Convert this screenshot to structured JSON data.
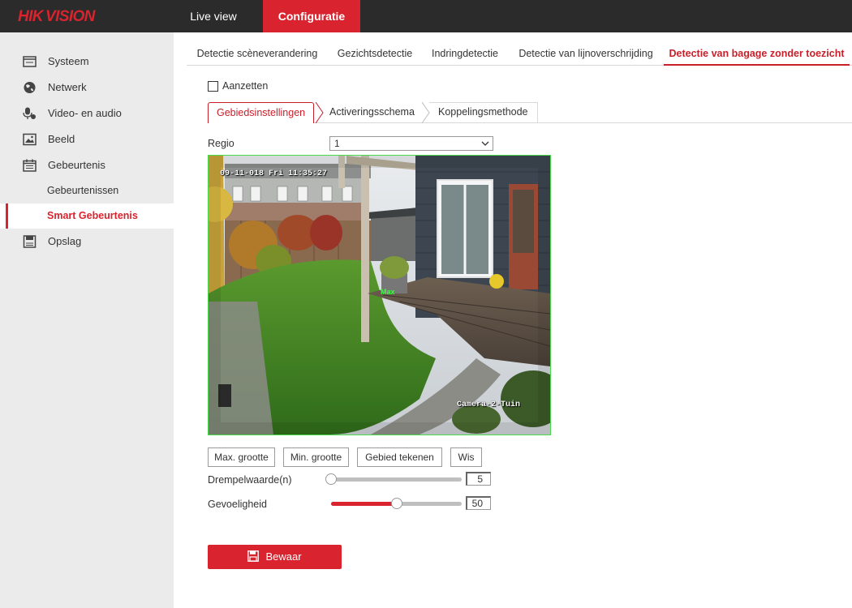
{
  "brand": {
    "logo": "HIKVISION"
  },
  "topnav": {
    "live_view": "Live view",
    "configuratie": "Configuratie"
  },
  "sidebar": {
    "items": [
      {
        "label": "Systeem",
        "icon": "monitor-icon"
      },
      {
        "label": "Netwerk",
        "icon": "globe-icon"
      },
      {
        "label": "Video- en audio",
        "icon": "microphone-icon"
      },
      {
        "label": "Beeld",
        "icon": "image-icon"
      },
      {
        "label": "Gebeurtenis",
        "icon": "calendar-icon"
      }
    ],
    "subitems": [
      {
        "label": "Gebeurtenissen",
        "active": false
      },
      {
        "label": "Smart Gebeurtenis",
        "active": true
      }
    ],
    "storage": {
      "label": "Opslag",
      "icon": "storage-icon"
    }
  },
  "detection_tabs": [
    "Detectie scèneverandering",
    "Gezichtsdetectie",
    "Indringdetectie",
    "Detectie van lijnoverschrijding",
    "Detectie van bagage zonder toezicht"
  ],
  "enable": {
    "label": "Aanzetten",
    "checked": false
  },
  "sub_tabs": [
    "Gebiedsinstellingen",
    "Activeringsschema",
    "Koppelingsmethode"
  ],
  "regio": {
    "label": "Regio",
    "value": "1"
  },
  "video": {
    "timestamp": "09-11-018 Fri 11:35:27",
    "camera_name": "Camera-2-Tuin",
    "center_mark": "Max"
  },
  "buttons": {
    "max": "Max. grootte",
    "min": "Min. grootte",
    "draw": "Gebied tekenen",
    "clear": "Wis"
  },
  "threshold": {
    "label": "Drempelwaarde(n)",
    "value": "5",
    "fraction": 0.0
  },
  "sensitivity": {
    "label": "Gevoeligheid",
    "value": "50",
    "fraction": 0.5
  },
  "save": {
    "label": "Bewaar"
  },
  "colors": {
    "accent": "#d9232e",
    "topbar": "#2b2b2b",
    "sidebar": "#ebebeb",
    "roi": "#4cd94c"
  }
}
